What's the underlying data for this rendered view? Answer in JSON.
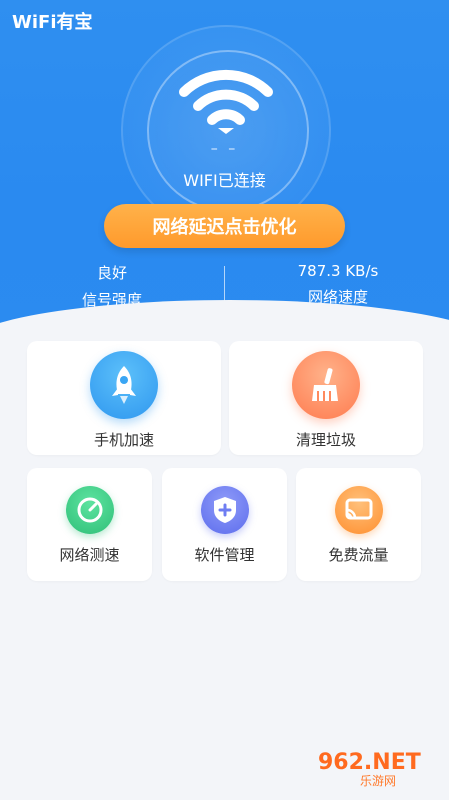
{
  "app": {
    "title": "WiFi有宝"
  },
  "network": {
    "dash": "– –",
    "status": "WIFI已连接"
  },
  "actions": {
    "optimize_label": "网络延迟点击优化"
  },
  "stats": {
    "signal": {
      "value": "良好",
      "label": "信号强度"
    },
    "speed": {
      "value": "787.3 KB/s",
      "label": "网络速度"
    }
  },
  "features_large": [
    {
      "label": "手机加速",
      "icon": "rocket-icon",
      "color": "#3aa6f4"
    },
    {
      "label": "清理垃圾",
      "icon": "broom-icon",
      "color": "#ff8a5e"
    }
  ],
  "features_small": [
    {
      "label": "网络测速",
      "icon": "speedometer-icon",
      "color": "#37c883"
    },
    {
      "label": "软件管理",
      "icon": "shield-icon",
      "color": "#6e7df2"
    },
    {
      "label": "免费流量",
      "icon": "cast-icon",
      "color": "#ff9a3c"
    }
  ],
  "watermark": {
    "top": "962.NET",
    "bottom": "乐游网"
  }
}
